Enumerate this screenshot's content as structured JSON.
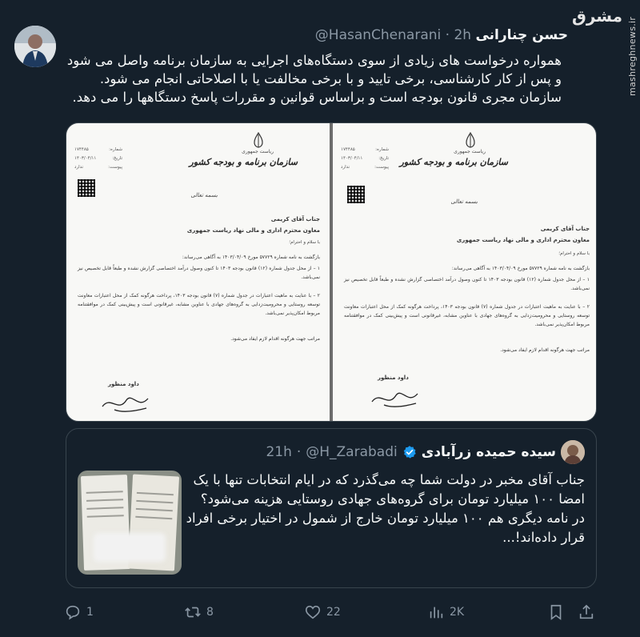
{
  "tweet": {
    "author_name": "حسن چنارانی",
    "author_handle": "@HasanChenarani",
    "time": "2h",
    "dot": "·",
    "text": "همواره درخواست های زیادی از سوی دستگاه‌های اجرایی به سازمان برنامه واصل می شود و پس از کار کارشناسی، برخی تایید و با برخی مخالفت یا با اصلاحاتی انجام می شود. سازمان مجری قانون بودجه است و براساس قوانین و مقررات پاسخ دستگاهها را می دهد."
  },
  "watermark": {
    "logo_text": "مشرق",
    "site": "mashreghnews.ir"
  },
  "document": {
    "header_small": "ریاست جمهوری",
    "org": "سازمان برنامه و بودجه کشور",
    "meta": [
      {
        "label": "شماره:",
        "value": "۱۷۴۴۸۵"
      },
      {
        "label": "تاریخ:",
        "value": "۱۴۰۳/۰۴/۱۱"
      },
      {
        "label": "پیوست:",
        "value": "ندارد"
      }
    ],
    "basmala": "بسمه تعالی",
    "addressee": "جناب آقای کریمی",
    "addressee_title": "معاون محترم اداری و مالی نهاد ریاست جمهوری",
    "salam": "با سلام و احترام؛",
    "para1": "بازگشت به نامه شماره ۵۷۷۲۹ مورخ ۱۴۰۳/۰۴/۰۹ به آگاهی می‌رساند:",
    "para2": "۱ – از محل جدول شماره (۱۲) قانون بودجه ۱۴۰۳ تا کنون وصول درآمد اختصاصی گزارش نشده و طبعاً قابل تخصیص نیز نمی‌باشد.",
    "para3": "۲ – با عنایت به ماهیت اعتبارات در جدول شماره (۷) قانون بودجه ۱۴۰۳، پرداخت هرگونه کمک از محل اعتبارات معاونت توسعه روستایی و محرومیت‌زدایی به گروه‌های جهادی با عناوین مشابه، غیرقانونی است و پیش‌بینی کمک در موافقتنامه مربوط امکان‌پذیر نمی‌باشد.",
    "para4": "مراتب جهت هرگونه اقدام لازم ایفاد می‌شود.",
    "signer": "داود منظور"
  },
  "quote": {
    "author_name": "سیده حمیده زرآبادی",
    "author_handle": "@H_Zarabadi",
    "time": "21h",
    "dot": "·",
    "text": "جناب آقای مخبر در دولت شما چه می‌گذرد که در ایام انتخابات تنها با یک امضا ۱۰۰ میلیارد تومان برای گروه‌های جهادی روستایی هزینه می‌شود؟ در نامه دیگری هم ۱۰۰ میلیارد تومان خارج از شمول در اختیار برخی افراد قرار داده‌اند!..."
  },
  "actions": {
    "reply_count": "1",
    "retweet_count": "8",
    "like_count": "22",
    "views_count": "2K"
  }
}
